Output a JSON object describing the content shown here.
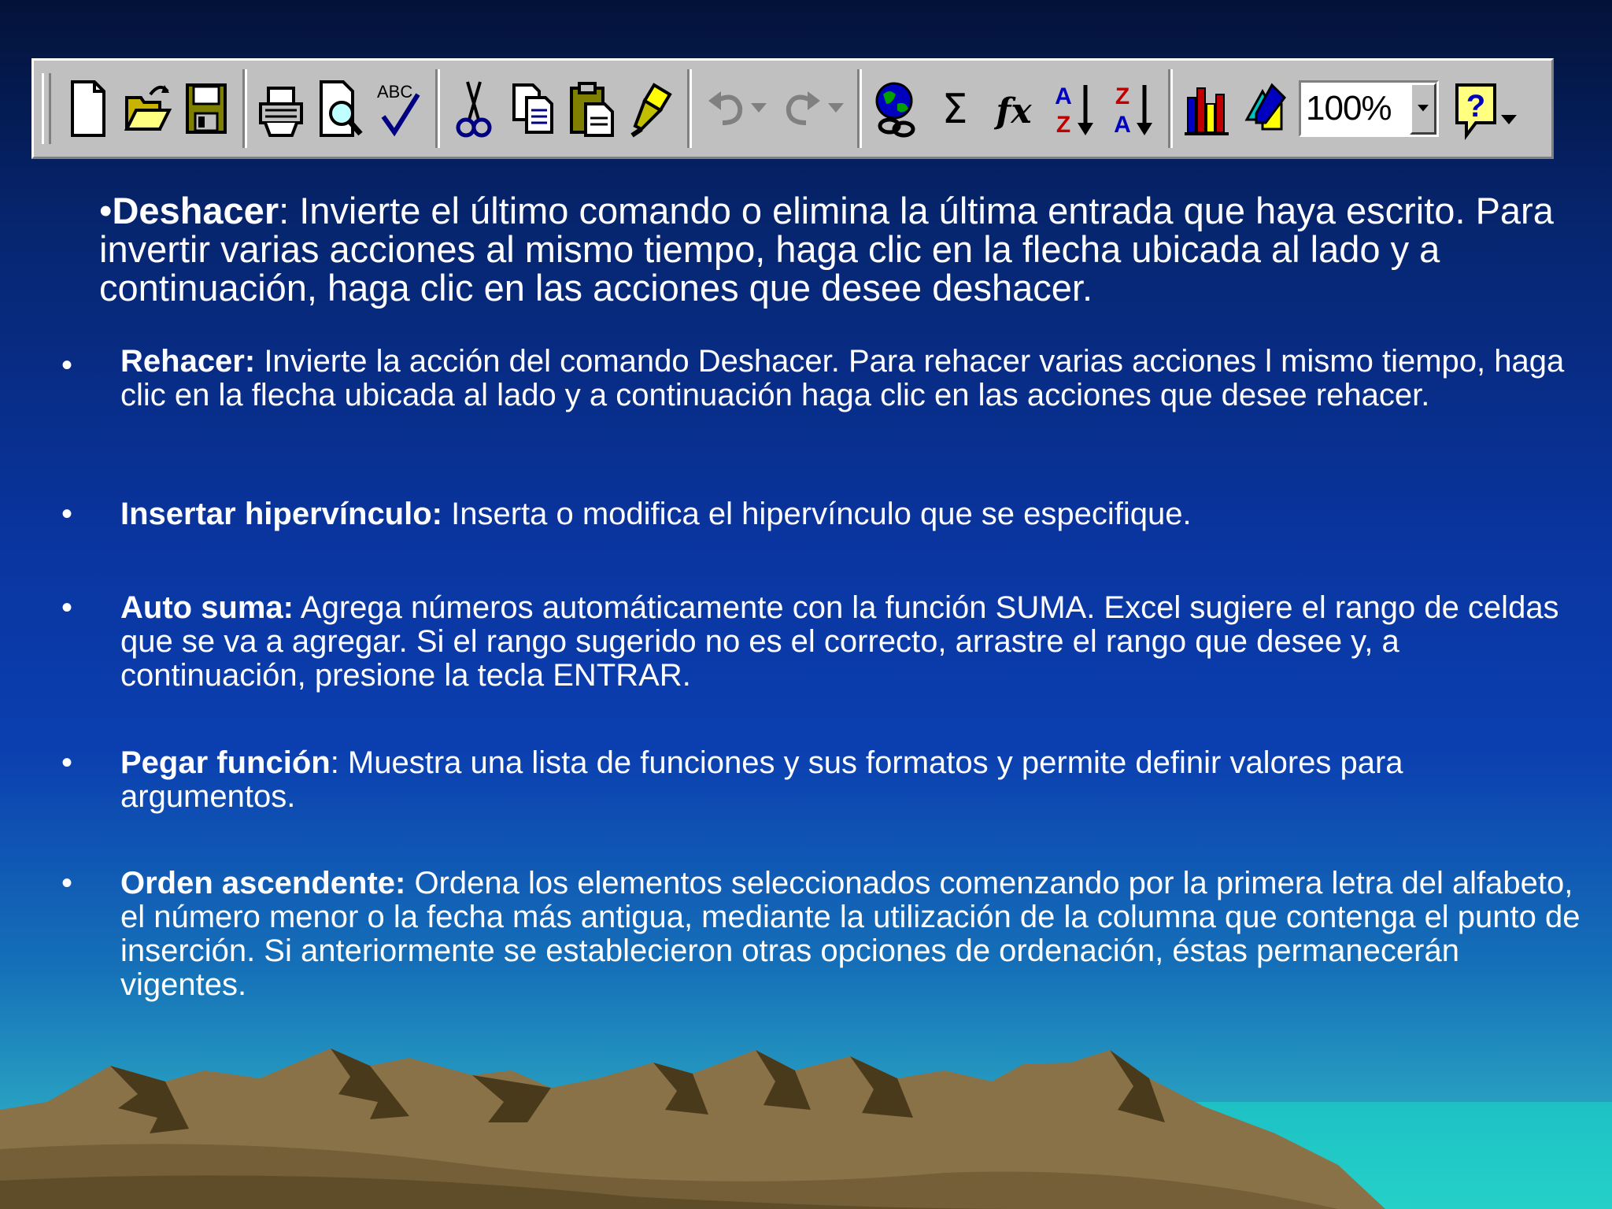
{
  "toolbar": {
    "buttons": [
      {
        "name": "new-document-icon",
        "tooltip": ""
      },
      {
        "name": "open-folder-icon",
        "tooltip": ""
      },
      {
        "name": "save-disk-icon",
        "tooltip": ""
      },
      {
        "name": "print-icon",
        "tooltip": ""
      },
      {
        "name": "print-preview-icon",
        "tooltip": ""
      },
      {
        "name": "spelling-icon",
        "tooltip": ""
      },
      {
        "name": "cut-icon",
        "tooltip": ""
      },
      {
        "name": "copy-icon",
        "tooltip": ""
      },
      {
        "name": "paste-icon",
        "tooltip": ""
      },
      {
        "name": "format-painter-icon",
        "tooltip": ""
      },
      {
        "name": "undo-icon",
        "tooltip": ""
      },
      {
        "name": "redo-icon",
        "tooltip": ""
      },
      {
        "name": "hyperlink-icon",
        "tooltip": ""
      },
      {
        "name": "autosum-icon",
        "tooltip": ""
      },
      {
        "name": "function-icon",
        "tooltip": ""
      },
      {
        "name": "sort-ascending-icon",
        "tooltip": ""
      },
      {
        "name": "sort-descending-icon",
        "tooltip": ""
      },
      {
        "name": "chart-wizard-icon",
        "tooltip": ""
      },
      {
        "name": "drawing-icon",
        "tooltip": ""
      },
      {
        "name": "help-icon",
        "tooltip": ""
      }
    ],
    "zoom_value": "100%",
    "glyphs": {
      "spelling": "ABC",
      "sigma": "Σ",
      "fx": "fx",
      "sort_asc_top": "A",
      "sort_asc_bottom": "Z",
      "sort_desc_top": "Z",
      "sort_desc_bottom": "A",
      "help": "?"
    }
  },
  "intro": {
    "bullet": "•",
    "term": "Deshacer",
    "text": ": Invierte el último comando o elimina la última entrada que haya escrito. Para invertir varias acciones al mismo tiempo, haga clic en la flecha ubicada al lado y a continuación, haga clic en las acciones que desee deshacer."
  },
  "items": [
    {
      "bullet": "•",
      "term": "Rehacer:",
      "text": " Invierte la acción del comando Deshacer. Para rehacer varias acciones l mismo tiempo, haga clic en la flecha ubicada al lado y a continuación haga clic en las acciones que desee rehacer."
    },
    {
      "bullet": "•",
      "term": "Insertar hipervínculo:",
      "text": " Inserta o modifica el hipervínculo que se especifique."
    },
    {
      "bullet": "•",
      "term": "Auto suma:",
      "text": " Agrega números automáticamente con la función SUMA. Excel sugiere el rango de celdas que se va a agregar. Si el rango sugerido no es el correcto, arrastre el rango que desee y, a continuación, presione la tecla ENTRAR."
    },
    {
      "bullet": "•",
      "term": "Pegar función",
      "text": ": Muestra una lista de funciones y sus formatos y permite definir valores para argumentos."
    },
    {
      "bullet": "•",
      "term": "Orden ascendente:",
      "text": " Ordena los elementos seleccionados comenzando por la primera letra del alfabeto, el número menor o la fecha más antigua, mediante la utilización de la columna que contenga el punto de inserción. Si anteriormente se establecieron otras opciones de ordenación, éstas permanecerán vigentes."
    }
  ],
  "colors": {
    "background_top": "#031238",
    "background_mid": "#0b3fb0",
    "background_bottom": "#3cc4c8",
    "toolbar_face": "#c0c0c0",
    "text": "#ffffff",
    "mountain": "#8a7248",
    "mountain_shadow": "#4a3a1c"
  }
}
